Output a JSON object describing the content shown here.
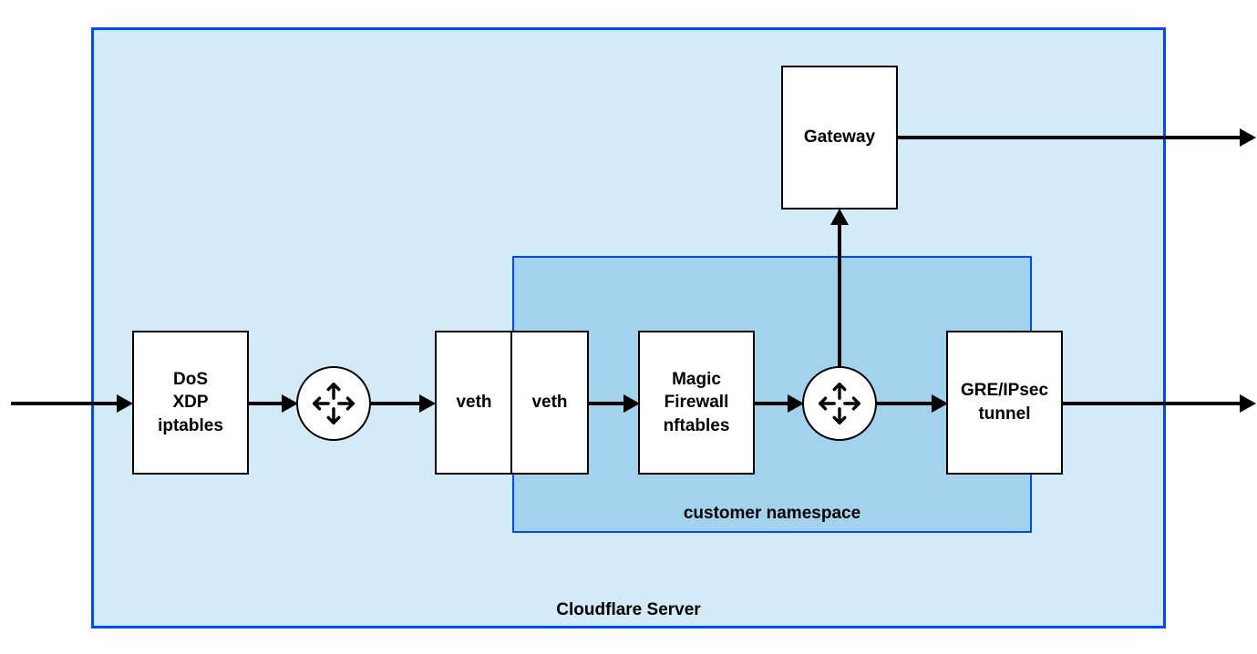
{
  "server": {
    "label": "Cloudflare Server"
  },
  "namespace": {
    "label": "customer namespace"
  },
  "boxes": {
    "dos": "DoS\nXDP\niptables",
    "veth1": "veth",
    "veth2": "veth",
    "magicfw": "Magic\nFirewall\nnftables",
    "gre": "GRE/IPsec\ntunnel",
    "gateway": "Gateway"
  }
}
